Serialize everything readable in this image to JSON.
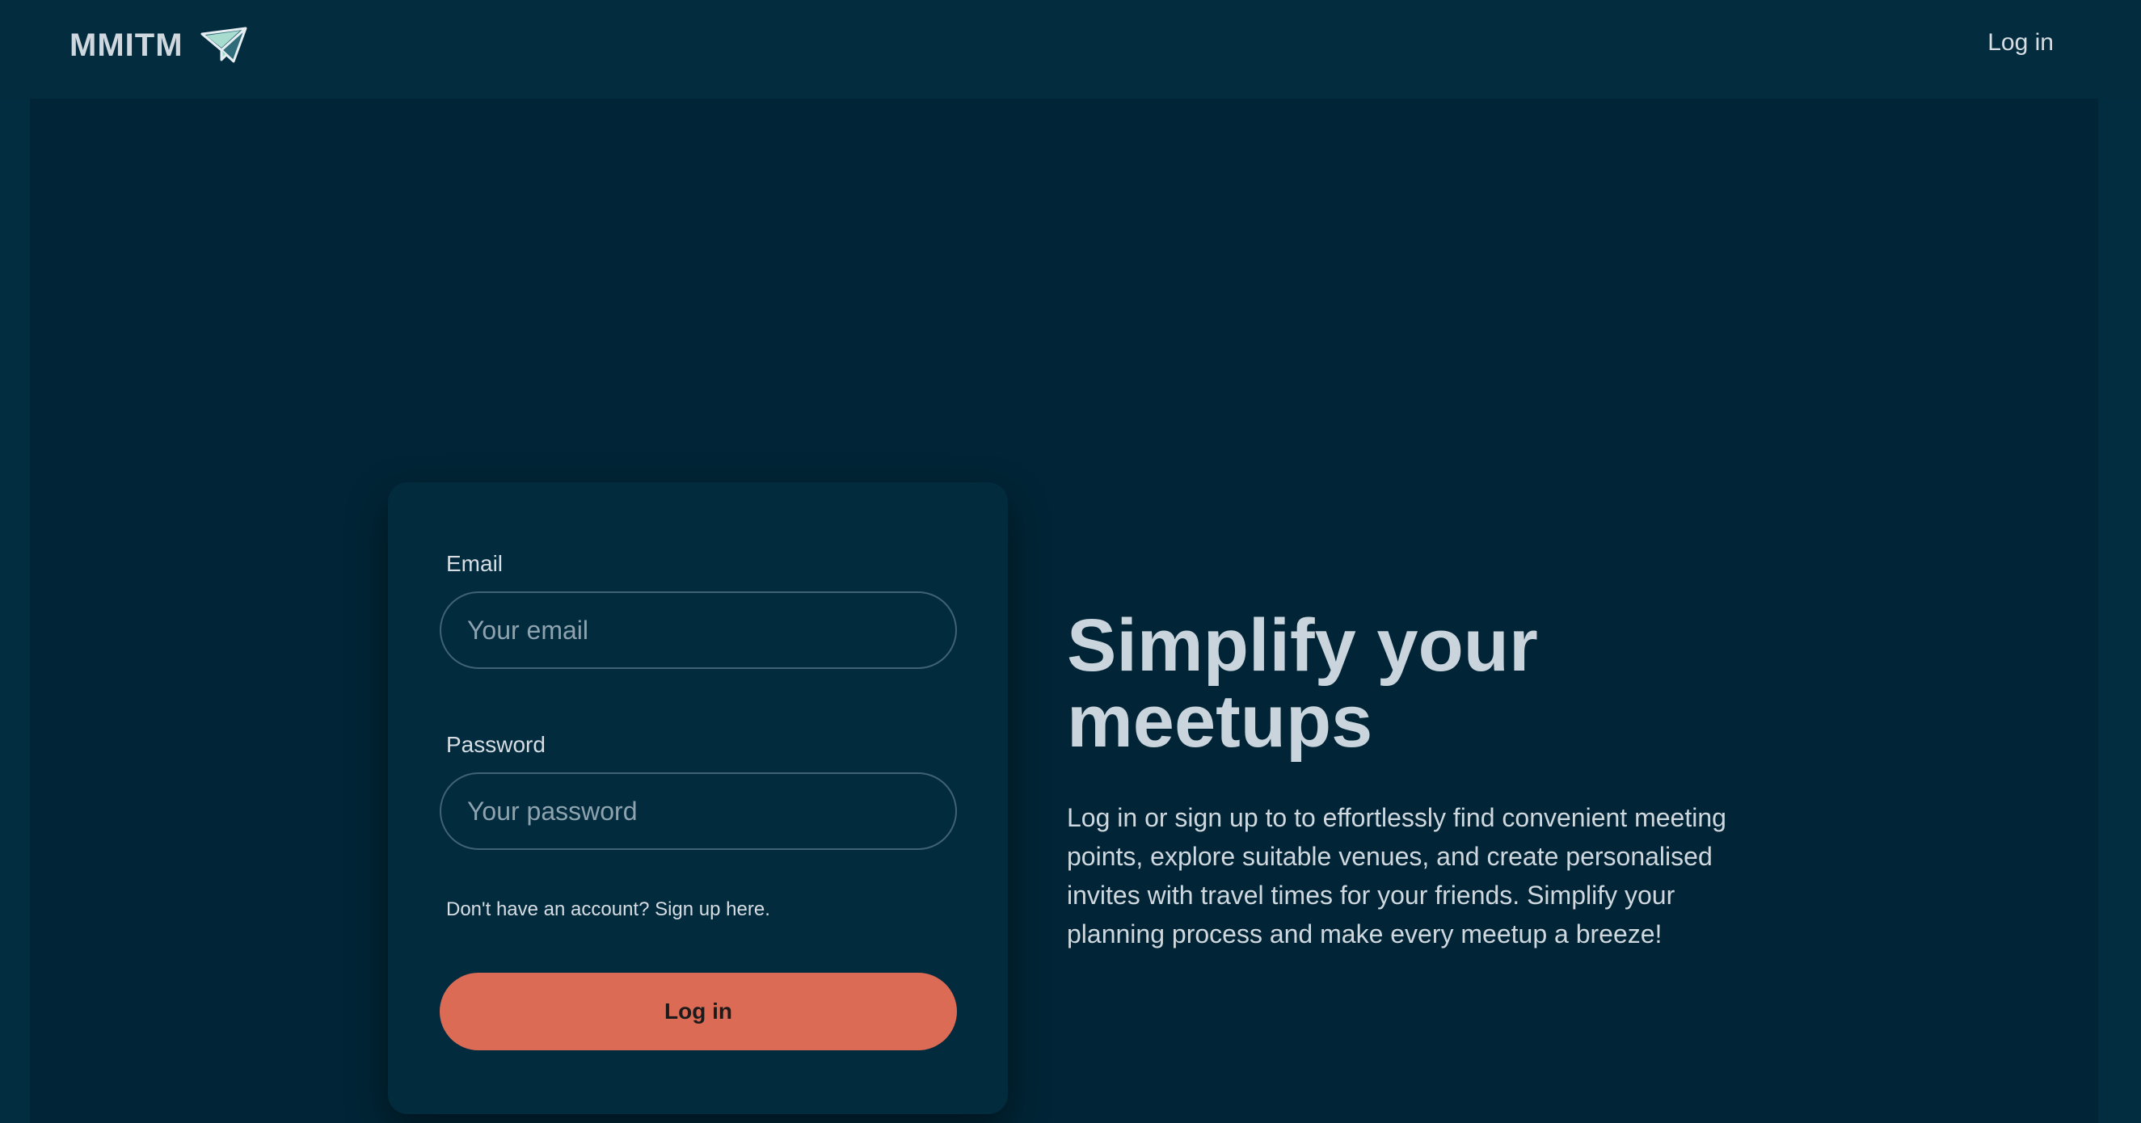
{
  "navbar": {
    "brand": "MMITM",
    "brand_icon": "paper-plane-icon",
    "login_label": "Log in"
  },
  "login_form": {
    "email_label": "Email",
    "email_placeholder": "Your email",
    "email_value": "",
    "password_label": "Password",
    "password_placeholder": "Your password",
    "password_value": "",
    "signup_text": "Don't have an account? Sign up here.",
    "submit_label": "Log in"
  },
  "hero": {
    "title": "Simplify your meetups",
    "description": "Log in or sign up to to effortlessly find convenient meeting points, explore suitable venues, and create personalised invites with travel times for your friends. Simplify your planning process and make every meetup a breeze!"
  },
  "colors": {
    "background": "#022c3f",
    "main_panel": "#012536",
    "card": "#022b3e",
    "accent": "#dc6b55",
    "text": "#d6dde3"
  }
}
